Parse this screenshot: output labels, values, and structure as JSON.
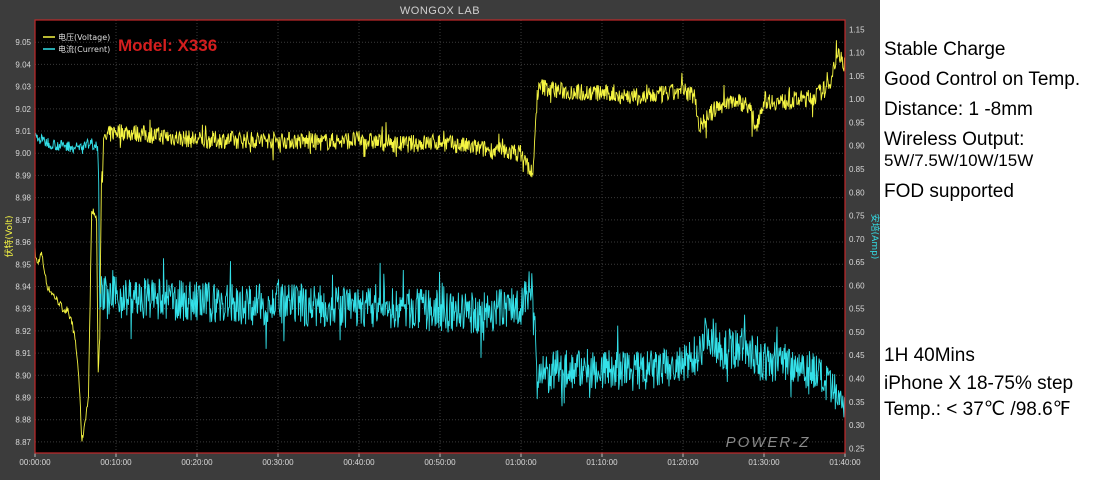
{
  "chart_data": {
    "type": "line",
    "title": "WONGOX LAB",
    "annotation": "Model: X336",
    "watermark": "POWER-Z",
    "ylabel_left": "伏特(Volt)",
    "ylabel_right": "安培(Amp)",
    "ylim_left": [
      8.865,
      9.06
    ],
    "ylim_right": [
      0.24,
      1.17
    ],
    "xlim_minutes": [
      0,
      100
    ],
    "yticks_left": [
      "8.87",
      "8.88",
      "8.89",
      "8.90",
      "8.91",
      "8.92",
      "8.93",
      "8.94",
      "8.95",
      "8.96",
      "8.97",
      "8.98",
      "8.99",
      "9.00",
      "9.01",
      "9.02",
      "9.03",
      "9.04",
      "9.05"
    ],
    "yticks_right": [
      "0.25",
      "0.30",
      "0.35",
      "0.40",
      "0.45",
      "0.50",
      "0.55",
      "0.60",
      "0.65",
      "0.70",
      "0.75",
      "0.80",
      "0.85",
      "0.90",
      "0.95",
      "1.00",
      "1.05",
      "1.10",
      "1.15"
    ],
    "xticks": [
      "00:00:00",
      "00:10:00",
      "00:20:00",
      "00:30:00",
      "00:40:00",
      "00:50:00",
      "01:00:00",
      "01:10:00",
      "01:20:00",
      "01:30:00",
      "01:40:00"
    ],
    "grid": true,
    "legend": "top-left",
    "series": [
      {
        "name": "电压(Voltage)",
        "axis": "left",
        "color": "#f5f542",
        "x": [
          0,
          0.3,
          0.8,
          1.5,
          2.5,
          3.5,
          4.5,
          5,
          5.4,
          5.8,
          6.2,
          6.6,
          7,
          7.3,
          7.6,
          7.8,
          8,
          8.2,
          8.5,
          9,
          10,
          15,
          20,
          25,
          30,
          35,
          40,
          45,
          50,
          55,
          60,
          61.5,
          62,
          62.5,
          65,
          70,
          75,
          80,
          81.5,
          82,
          84,
          86,
          88,
          89,
          90,
          92,
          94,
          96,
          98,
          99,
          100
        ],
        "y": [
          8.955,
          8.95,
          8.955,
          8.94,
          8.935,
          8.93,
          8.925,
          8.915,
          8.9,
          8.87,
          8.88,
          8.89,
          8.975,
          8.973,
          8.97,
          8.9,
          8.92,
          8.99,
          9.005,
          9.008,
          9.01,
          9.008,
          9.006,
          9.006,
          9.006,
          9.005,
          9.006,
          9.004,
          9.005,
          9.002,
          9.0,
          8.99,
          9.027,
          9.03,
          9.028,
          9.027,
          9.025,
          9.028,
          9.026,
          9.012,
          9.02,
          9.024,
          9.022,
          9.012,
          9.024,
          9.023,
          9.024,
          9.025,
          9.03,
          9.045,
          9.04
        ]
      },
      {
        "name": "电流(Current)",
        "axis": "right",
        "color": "#33e0e8",
        "x": [
          0,
          1,
          2,
          3,
          4,
          5,
          6,
          7,
          7.8,
          8,
          9,
          10,
          15,
          20,
          25,
          30,
          35,
          40,
          45,
          50,
          55,
          60,
          61.5,
          62,
          65,
          70,
          75,
          80,
          82,
          83,
          85,
          87,
          89,
          90,
          92,
          94,
          96,
          98,
          100
        ],
        "y": [
          0.92,
          0.91,
          0.905,
          0.9,
          0.9,
          0.895,
          0.9,
          0.905,
          0.9,
          0.59,
          0.57,
          0.575,
          0.57,
          0.565,
          0.56,
          0.558,
          0.555,
          0.552,
          0.55,
          0.545,
          0.54,
          0.56,
          0.6,
          0.4,
          0.42,
          0.42,
          0.415,
          0.425,
          0.46,
          0.5,
          0.46,
          0.47,
          0.45,
          0.43,
          0.44,
          0.43,
          0.42,
          0.38,
          0.34
        ]
      }
    ]
  },
  "notes": {
    "line1": "Stable Charge",
    "line2": "Good Control on Temp.",
    "line3": "Distance: 1 -8mm",
    "line4": "Wireless Output:",
    "line5": "5W/7.5W/10W/15W",
    "line6": "FOD supported",
    "line7": "1H 40Mins",
    "line8": "iPhone X 18-75% step",
    "line9": "Temp.: < 37℃ /98.6℉"
  }
}
